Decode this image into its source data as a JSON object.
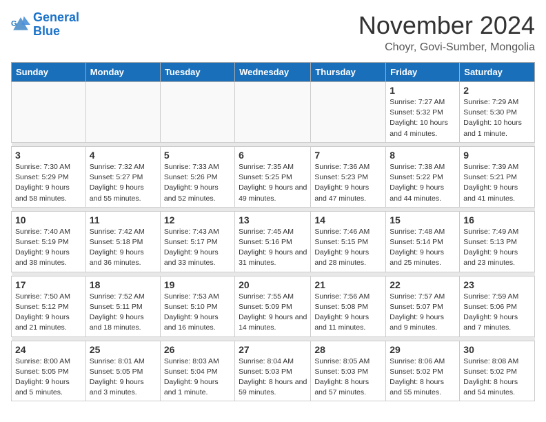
{
  "logo": {
    "line1": "General",
    "line2": "Blue"
  },
  "title": "November 2024",
  "location": "Choyr, Govi-Sumber, Mongolia",
  "days_of_week": [
    "Sunday",
    "Monday",
    "Tuesday",
    "Wednesday",
    "Thursday",
    "Friday",
    "Saturday"
  ],
  "weeks": [
    [
      {
        "day": "",
        "detail": ""
      },
      {
        "day": "",
        "detail": ""
      },
      {
        "day": "",
        "detail": ""
      },
      {
        "day": "",
        "detail": ""
      },
      {
        "day": "",
        "detail": ""
      },
      {
        "day": "1",
        "detail": "Sunrise: 7:27 AM\nSunset: 5:32 PM\nDaylight: 10 hours\nand 4 minutes."
      },
      {
        "day": "2",
        "detail": "Sunrise: 7:29 AM\nSunset: 5:30 PM\nDaylight: 10 hours\nand 1 minute."
      }
    ],
    [
      {
        "day": "3",
        "detail": "Sunrise: 7:30 AM\nSunset: 5:29 PM\nDaylight: 9 hours\nand 58 minutes."
      },
      {
        "day": "4",
        "detail": "Sunrise: 7:32 AM\nSunset: 5:27 PM\nDaylight: 9 hours\nand 55 minutes."
      },
      {
        "day": "5",
        "detail": "Sunrise: 7:33 AM\nSunset: 5:26 PM\nDaylight: 9 hours\nand 52 minutes."
      },
      {
        "day": "6",
        "detail": "Sunrise: 7:35 AM\nSunset: 5:25 PM\nDaylight: 9 hours\nand 49 minutes."
      },
      {
        "day": "7",
        "detail": "Sunrise: 7:36 AM\nSunset: 5:23 PM\nDaylight: 9 hours\nand 47 minutes."
      },
      {
        "day": "8",
        "detail": "Sunrise: 7:38 AM\nSunset: 5:22 PM\nDaylight: 9 hours\nand 44 minutes."
      },
      {
        "day": "9",
        "detail": "Sunrise: 7:39 AM\nSunset: 5:21 PM\nDaylight: 9 hours\nand 41 minutes."
      }
    ],
    [
      {
        "day": "10",
        "detail": "Sunrise: 7:40 AM\nSunset: 5:19 PM\nDaylight: 9 hours\nand 38 minutes."
      },
      {
        "day": "11",
        "detail": "Sunrise: 7:42 AM\nSunset: 5:18 PM\nDaylight: 9 hours\nand 36 minutes."
      },
      {
        "day": "12",
        "detail": "Sunrise: 7:43 AM\nSunset: 5:17 PM\nDaylight: 9 hours\nand 33 minutes."
      },
      {
        "day": "13",
        "detail": "Sunrise: 7:45 AM\nSunset: 5:16 PM\nDaylight: 9 hours\nand 31 minutes."
      },
      {
        "day": "14",
        "detail": "Sunrise: 7:46 AM\nSunset: 5:15 PM\nDaylight: 9 hours\nand 28 minutes."
      },
      {
        "day": "15",
        "detail": "Sunrise: 7:48 AM\nSunset: 5:14 PM\nDaylight: 9 hours\nand 25 minutes."
      },
      {
        "day": "16",
        "detail": "Sunrise: 7:49 AM\nSunset: 5:13 PM\nDaylight: 9 hours\nand 23 minutes."
      }
    ],
    [
      {
        "day": "17",
        "detail": "Sunrise: 7:50 AM\nSunset: 5:12 PM\nDaylight: 9 hours\nand 21 minutes."
      },
      {
        "day": "18",
        "detail": "Sunrise: 7:52 AM\nSunset: 5:11 PM\nDaylight: 9 hours\nand 18 minutes."
      },
      {
        "day": "19",
        "detail": "Sunrise: 7:53 AM\nSunset: 5:10 PM\nDaylight: 9 hours\nand 16 minutes."
      },
      {
        "day": "20",
        "detail": "Sunrise: 7:55 AM\nSunset: 5:09 PM\nDaylight: 9 hours\nand 14 minutes."
      },
      {
        "day": "21",
        "detail": "Sunrise: 7:56 AM\nSunset: 5:08 PM\nDaylight: 9 hours\nand 11 minutes."
      },
      {
        "day": "22",
        "detail": "Sunrise: 7:57 AM\nSunset: 5:07 PM\nDaylight: 9 hours\nand 9 minutes."
      },
      {
        "day": "23",
        "detail": "Sunrise: 7:59 AM\nSunset: 5:06 PM\nDaylight: 9 hours\nand 7 minutes."
      }
    ],
    [
      {
        "day": "24",
        "detail": "Sunrise: 8:00 AM\nSunset: 5:05 PM\nDaylight: 9 hours\nand 5 minutes."
      },
      {
        "day": "25",
        "detail": "Sunrise: 8:01 AM\nSunset: 5:05 PM\nDaylight: 9 hours\nand 3 minutes."
      },
      {
        "day": "26",
        "detail": "Sunrise: 8:03 AM\nSunset: 5:04 PM\nDaylight: 9 hours\nand 1 minute."
      },
      {
        "day": "27",
        "detail": "Sunrise: 8:04 AM\nSunset: 5:03 PM\nDaylight: 8 hours\nand 59 minutes."
      },
      {
        "day": "28",
        "detail": "Sunrise: 8:05 AM\nSunset: 5:03 PM\nDaylight: 8 hours\nand 57 minutes."
      },
      {
        "day": "29",
        "detail": "Sunrise: 8:06 AM\nSunset: 5:02 PM\nDaylight: 8 hours\nand 55 minutes."
      },
      {
        "day": "30",
        "detail": "Sunrise: 8:08 AM\nSunset: 5:02 PM\nDaylight: 8 hours\nand 54 minutes."
      }
    ]
  ]
}
